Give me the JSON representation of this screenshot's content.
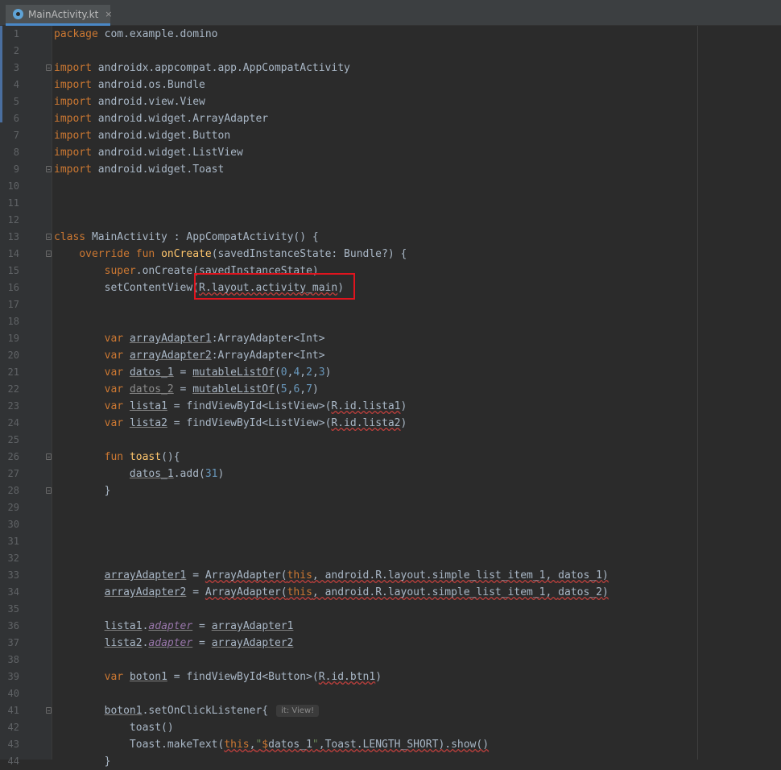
{
  "tab": {
    "label": "MainActivity.kt",
    "close": "×"
  },
  "lines": [
    {
      "n": "1",
      "spans": [
        {
          "t": "package ",
          "c": "kw"
        },
        {
          "t": "com.example.domino"
        }
      ]
    },
    {
      "n": "2",
      "spans": []
    },
    {
      "n": "3",
      "fold": true,
      "spans": [
        {
          "t": "import ",
          "c": "kw"
        },
        {
          "t": "androidx.appcompat.app.AppCompatActivity"
        }
      ]
    },
    {
      "n": "4",
      "spans": [
        {
          "t": "import ",
          "c": "kw"
        },
        {
          "t": "android.os.Bundle"
        }
      ]
    },
    {
      "n": "5",
      "spans": [
        {
          "t": "import ",
          "c": "kw"
        },
        {
          "t": "android.view.View"
        }
      ]
    },
    {
      "n": "6",
      "spans": [
        {
          "t": "import ",
          "c": "kw"
        },
        {
          "t": "android.widget.ArrayAdapter"
        }
      ]
    },
    {
      "n": "7",
      "spans": [
        {
          "t": "import ",
          "c": "kw"
        },
        {
          "t": "android.widget.Button"
        }
      ]
    },
    {
      "n": "8",
      "spans": [
        {
          "t": "import ",
          "c": "kw"
        },
        {
          "t": "android.widget.ListView"
        }
      ]
    },
    {
      "n": "9",
      "fold": true,
      "spans": [
        {
          "t": "import ",
          "c": "kw"
        },
        {
          "t": "android.widget.Toast"
        }
      ]
    },
    {
      "n": "10",
      "spans": []
    },
    {
      "n": "11",
      "spans": []
    },
    {
      "n": "12",
      "spans": []
    },
    {
      "n": "13",
      "fold": true,
      "spans": [
        {
          "t": "class ",
          "c": "kw"
        },
        {
          "t": "MainActivity : AppCompatActivity() {"
        }
      ]
    },
    {
      "n": "14",
      "fold": true,
      "spans": [
        {
          "t": "    "
        },
        {
          "t": "override fun ",
          "c": "kw"
        },
        {
          "t": "onCreate",
          "c": "fn"
        },
        {
          "t": "(savedInstanceState: Bundle?) {"
        }
      ]
    },
    {
      "n": "15",
      "spans": [
        {
          "t": "        "
        },
        {
          "t": "super",
          "c": "kw"
        },
        {
          "t": ".onCreate(savedInstanceState)"
        }
      ]
    },
    {
      "n": "16",
      "spans": [
        {
          "t": "        setContentView("
        },
        {
          "t": "R.layout.activity_main",
          "c": "err"
        },
        {
          "t": ")"
        }
      ]
    },
    {
      "n": "17",
      "spans": []
    },
    {
      "n": "18",
      "spans": []
    },
    {
      "n": "19",
      "spans": [
        {
          "t": "        "
        },
        {
          "t": "var ",
          "c": "kw"
        },
        {
          "t": "arrayAdapter1",
          "c": "ul"
        },
        {
          "t": ":ArrayAdapter<Int>"
        }
      ]
    },
    {
      "n": "20",
      "spans": [
        {
          "t": "        "
        },
        {
          "t": "var ",
          "c": "kw"
        },
        {
          "t": "arrayAdapter2",
          "c": "ul"
        },
        {
          "t": ":ArrayAdapter<Int>"
        }
      ]
    },
    {
      "n": "21",
      "spans": [
        {
          "t": "        "
        },
        {
          "t": "var ",
          "c": "kw"
        },
        {
          "t": "datos_1",
          "c": "ul"
        },
        {
          "t": " = "
        },
        {
          "t": "mutableListOf",
          "c": "ul"
        },
        {
          "t": "("
        },
        {
          "t": "0",
          "c": "num"
        },
        {
          "t": ","
        },
        {
          "t": "4",
          "c": "num"
        },
        {
          "t": ","
        },
        {
          "t": "2",
          "c": "num"
        },
        {
          "t": ","
        },
        {
          "t": "3",
          "c": "num"
        },
        {
          "t": ")"
        }
      ]
    },
    {
      "n": "22",
      "spans": [
        {
          "t": "        "
        },
        {
          "t": "var ",
          "c": "kw"
        },
        {
          "t": "datos_2",
          "c": "ul dim"
        },
        {
          "t": " = "
        },
        {
          "t": "mutableListOf",
          "c": "ul"
        },
        {
          "t": "("
        },
        {
          "t": "5",
          "c": "num"
        },
        {
          "t": ","
        },
        {
          "t": "6",
          "c": "num"
        },
        {
          "t": ","
        },
        {
          "t": "7",
          "c": "num"
        },
        {
          "t": ")"
        }
      ]
    },
    {
      "n": "23",
      "spans": [
        {
          "t": "        "
        },
        {
          "t": "var ",
          "c": "kw"
        },
        {
          "t": "lista1",
          "c": "ul"
        },
        {
          "t": " = findViewById<ListView>("
        },
        {
          "t": "R.id.lista1",
          "c": "err"
        },
        {
          "t": ")"
        }
      ]
    },
    {
      "n": "24",
      "spans": [
        {
          "t": "        "
        },
        {
          "t": "var ",
          "c": "kw"
        },
        {
          "t": "lista2",
          "c": "ul"
        },
        {
          "t": " = findViewById<ListView>("
        },
        {
          "t": "R.id.lista2",
          "c": "err"
        },
        {
          "t": ")"
        }
      ]
    },
    {
      "n": "25",
      "spans": []
    },
    {
      "n": "26",
      "fold": true,
      "spans": [
        {
          "t": "        "
        },
        {
          "t": "fun ",
          "c": "kw"
        },
        {
          "t": "toast",
          "c": "fn"
        },
        {
          "t": "(){"
        }
      ]
    },
    {
      "n": "27",
      "spans": [
        {
          "t": "            "
        },
        {
          "t": "datos_1",
          "c": "ul"
        },
        {
          "t": ".add("
        },
        {
          "t": "31",
          "c": "num"
        },
        {
          "t": ")"
        }
      ]
    },
    {
      "n": "28",
      "fold": true,
      "spans": [
        {
          "t": "        }"
        }
      ]
    },
    {
      "n": "29",
      "spans": []
    },
    {
      "n": "30",
      "spans": []
    },
    {
      "n": "31",
      "spans": []
    },
    {
      "n": "32",
      "spans": []
    },
    {
      "n": "33",
      "spans": [
        {
          "t": "        "
        },
        {
          "t": "arrayAdapter1",
          "c": "ul"
        },
        {
          "t": " = "
        },
        {
          "t": "ArrayAdapter(",
          "c": "err"
        },
        {
          "t": "this",
          "c": "kw err"
        },
        {
          "t": ", android.R.layout.simple_list_item_1, ",
          "c": "err"
        },
        {
          "t": "datos_1",
          "c": "ul err"
        },
        {
          "t": ")",
          "c": "err"
        }
      ]
    },
    {
      "n": "34",
      "spans": [
        {
          "t": "        "
        },
        {
          "t": "arrayAdapter2",
          "c": "ul"
        },
        {
          "t": " = "
        },
        {
          "t": "ArrayAdapter(",
          "c": "err"
        },
        {
          "t": "this",
          "c": "kw err"
        },
        {
          "t": ", android.R.layout.simple_list_item_1, ",
          "c": "err"
        },
        {
          "t": "datos_2",
          "c": "ul err"
        },
        {
          "t": ")",
          "c": "err"
        }
      ]
    },
    {
      "n": "35",
      "spans": []
    },
    {
      "n": "36",
      "spans": [
        {
          "t": "        "
        },
        {
          "t": "lista1",
          "c": "ul"
        },
        {
          "t": "."
        },
        {
          "t": "adapter",
          "c": "prop ul"
        },
        {
          "t": " = "
        },
        {
          "t": "arrayAdapter1",
          "c": "ul"
        }
      ]
    },
    {
      "n": "37",
      "spans": [
        {
          "t": "        "
        },
        {
          "t": "lista2",
          "c": "ul"
        },
        {
          "t": "."
        },
        {
          "t": "adapter",
          "c": "prop ul"
        },
        {
          "t": " = "
        },
        {
          "t": "arrayAdapter2",
          "c": "ul"
        }
      ]
    },
    {
      "n": "38",
      "spans": []
    },
    {
      "n": "39",
      "spans": [
        {
          "t": "        "
        },
        {
          "t": "var ",
          "c": "kw"
        },
        {
          "t": "boton1",
          "c": "ul"
        },
        {
          "t": " = findViewById<Button>("
        },
        {
          "t": "R.id.btn1",
          "c": "err"
        },
        {
          "t": ")"
        }
      ]
    },
    {
      "n": "40",
      "spans": []
    },
    {
      "n": "41",
      "fold": true,
      "hint": "it: View!",
      "spans": [
        {
          "t": "        "
        },
        {
          "t": "boton1",
          "c": "ul"
        },
        {
          "t": ".setOnClickListener{"
        }
      ]
    },
    {
      "n": "42",
      "spans": [
        {
          "t": "            toast()"
        }
      ]
    },
    {
      "n": "43",
      "spans": [
        {
          "t": "            Toast.makeText("
        },
        {
          "t": "this",
          "c": "kw err"
        },
        {
          "t": ",",
          "c": "err"
        },
        {
          "t": "\"",
          "c": "str err"
        },
        {
          "t": "$",
          "c": "kw err"
        },
        {
          "t": "datos_1",
          "c": "err"
        },
        {
          "t": "\"",
          "c": "str err"
        },
        {
          "t": ",Toast.LENGTH_SHORT).show()",
          "c": "err"
        }
      ]
    },
    {
      "n": "44",
      "spans": [
        {
          "t": "        }"
        }
      ]
    }
  ]
}
